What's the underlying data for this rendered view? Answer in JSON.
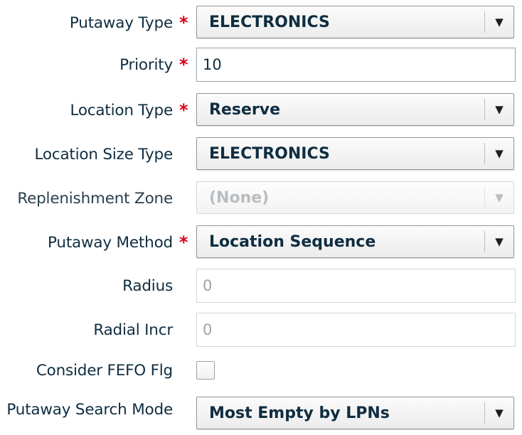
{
  "form": {
    "putaway_type": {
      "label": "Putaway Type",
      "required": "*",
      "value": "ELECTRONICS",
      "arrow": "▼"
    },
    "priority": {
      "label": "Priority",
      "required": "*",
      "value": "10"
    },
    "location_type": {
      "label": "Location Type",
      "required": "*",
      "value": "Reserve",
      "arrow": "▼"
    },
    "location_size_type": {
      "label": "Location Size Type",
      "value": "ELECTRONICS",
      "arrow": "▼"
    },
    "replenishment_zone": {
      "label": "Replenishment Zone",
      "value": "(None)",
      "arrow": "▼",
      "disabled": true
    },
    "putaway_method": {
      "label": "Putaway Method",
      "required": "*",
      "value": "Location Sequence",
      "arrow": "▼"
    },
    "radius": {
      "label": "Radius",
      "value": "0"
    },
    "radial_incr": {
      "label": "Radial Incr",
      "value": "0"
    },
    "consider_fefo_flg": {
      "label": "Consider FEFO Flg",
      "checked": false
    },
    "putaway_search_mode": {
      "label": "Putaway Search Mode",
      "value": "Most Empty by LPNs",
      "arrow": "▼"
    }
  },
  "colors": {
    "label_text": "#0f2d40",
    "required_star": "#d0021b",
    "disabled_text": "#b9bdc0"
  }
}
